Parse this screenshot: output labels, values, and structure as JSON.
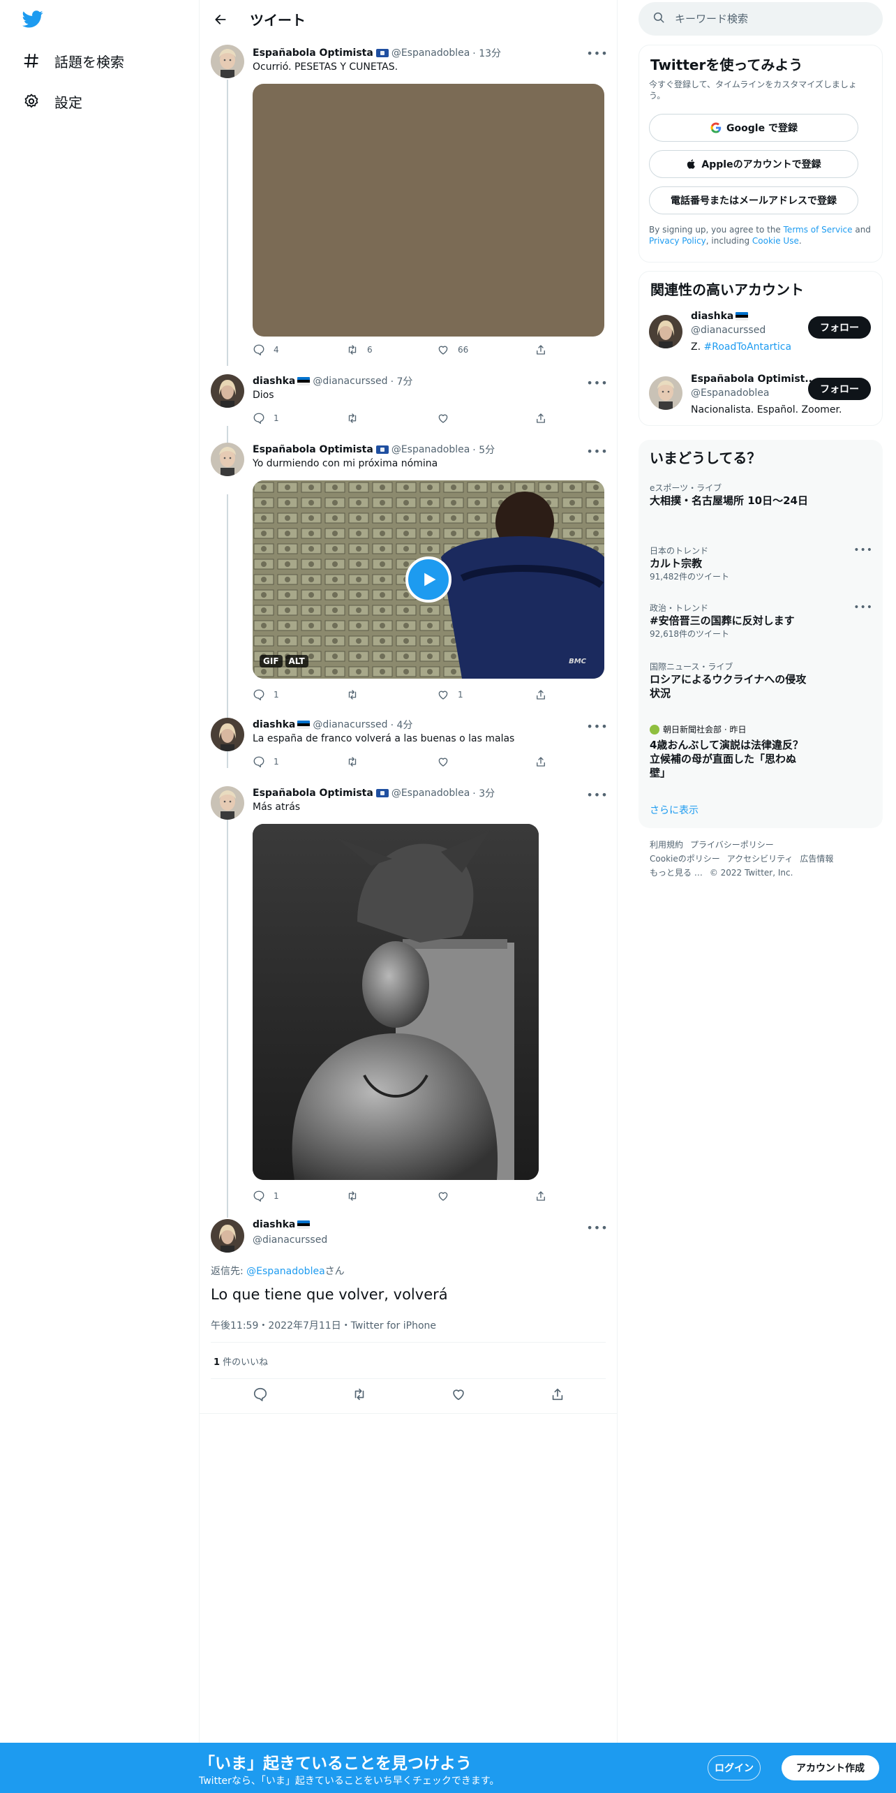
{
  "nav": {
    "logo": "twitter-bird-icon",
    "items": [
      {
        "label": "話題を検索",
        "icon": "hashtag-icon"
      },
      {
        "label": "設定",
        "icon": "gear-icon"
      }
    ]
  },
  "header": {
    "title": "ツイート",
    "back_icon": "arrow-left-icon"
  },
  "tweets": [
    {
      "name": "Españabola Optimista",
      "handle": "@Espanadoblea",
      "time": "· 13分",
      "text": "Ocurrió. PESETAS Y CUNETAS.",
      "replies": "4",
      "retweets": "6",
      "likes": "66"
    },
    {
      "name": "diashka",
      "handle": "@dianacurssed",
      "time": "· 7分",
      "text": "Dios",
      "replies": "1",
      "retweets": "",
      "likes": ""
    },
    {
      "name": "Españabola Optimista",
      "handle": "@Espanadoblea",
      "time": "· 5分",
      "text": "Yo durmiendo con mi próxima nómina",
      "media_badges": [
        "GIF",
        "ALT"
      ],
      "media_watermark": "BMC",
      "replies": "1",
      "retweets": "",
      "likes": "1"
    },
    {
      "name": "diashka",
      "handle": "@dianacurssed",
      "time": "· 4分",
      "text": "La españa de franco volverá a las buenas o las malas",
      "replies": "1",
      "retweets": "",
      "likes": ""
    },
    {
      "name": "Españabola Optimista",
      "handle": "@Espanadoblea",
      "time": "· 3分",
      "text": "Más atrás",
      "replies": "1",
      "retweets": "",
      "likes": ""
    }
  ],
  "main_tweet": {
    "name": "diashka",
    "handle": "@dianacurssed",
    "reply_prefix": "返信先: ",
    "reply_to": "@Espanadoblea",
    "reply_suffix": "さん",
    "text": "Lo que tiene que volver, volverá",
    "meta": "午後11:59・2022年7月11日・Twitter for iPhone",
    "likes_count": "1",
    "likes_label": " 件のいいね"
  },
  "search": {
    "placeholder": "キーワード検索"
  },
  "signup_panel": {
    "title": "Twitterを使ってみよう",
    "subtitle": "今すぐ登録して、タイムラインをカスタマイズしましょう。",
    "google": "Google で登録",
    "apple": "Appleのアカウントで登録",
    "phone": "電話番号またはメールアドレスで登録",
    "legal_1": "By signing up, you agree to the ",
    "tos": "Terms of Service",
    "legal_2": " and ",
    "privacy": "Privacy Policy",
    "legal_3": ", including ",
    "cookie": "Cookie Use",
    "legal_4": "."
  },
  "relevant": {
    "title": "関連性の高いアカウント",
    "follow_label": "フォロー",
    "accounts": [
      {
        "name": "diashka",
        "handle": "@dianacurssed",
        "bio_prefix": "Z. ",
        "bio_link": "#RoadToAntartica"
      },
      {
        "name": "Españabola Optimist...",
        "handle": "@Espanadoblea",
        "bio_prefix": "Nacionalista. Español. Zoomer.",
        "bio_link": ""
      }
    ]
  },
  "trends": {
    "title": "いまどうしてる？",
    "items": [
      {
        "category": "eスポーツ・ライブ",
        "title": "大相撲・名古屋場所 10日〜24日",
        "count": ""
      },
      {
        "category": "日本のトレンド",
        "title": "カルト宗教",
        "count": "91,482件のツイート"
      },
      {
        "category": "政治・トレンド",
        "title": "#安倍晋三の国葬に反対します",
        "count": "92,618件のツイート"
      },
      {
        "category": "国際ニュース・ライブ",
        "title": "ロシアによるウクライナへの侵攻状況",
        "count": ""
      },
      {
        "category": "朝日新聞社会部 · 昨日",
        "title": "4歳おんぶして演説は法律違反？ 立候補の母が直面した「思わぬ壁」",
        "count": ""
      }
    ],
    "show_more": "さらに表示"
  },
  "footer": {
    "links": [
      "利用規約",
      "プライバシーポリシー",
      "Cookieのポリシー",
      "アクセシビリティ",
      "広告情報",
      "もっと見る …",
      "© 2022 Twitter, Inc."
    ]
  },
  "bottom_bar": {
    "title": "「いま」起きていることを見つけよう",
    "subtitle": "Twitterなら、「いま」起きていることをいち早くチェックできます。",
    "login": "ログイン",
    "signup": "アカウント作成"
  },
  "colors": {
    "accent": "#1d9bf0",
    "text": "#0f1419",
    "muted": "#536471",
    "border": "#eff3f4"
  }
}
